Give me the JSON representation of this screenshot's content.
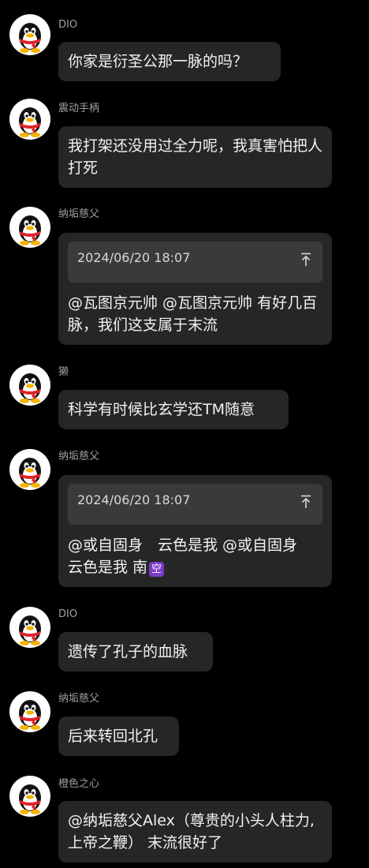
{
  "messages": [
    {
      "sender": "DIO",
      "text": "你家是衍圣公那一脉的吗？"
    },
    {
      "sender": "震动手柄",
      "text": "我打架还没用过全力呢，我真害怕把人打死"
    },
    {
      "sender": "纳垢慈父",
      "quote_time": "2024/06/20 18:07",
      "text": "@瓦图京元帅 @瓦图京元帅 有好几百脉，我们这支属于末流"
    },
    {
      "sender": "獭",
      "text": "科学有时候比玄学还TM随意"
    },
    {
      "sender": "纳垢慈父",
      "quote_time": "2024/06/20 18:07",
      "text": "@或自固身　云色是我 @或自固身　云色是我 南",
      "emoji": "空"
    },
    {
      "sender": "DIO",
      "text": "遗传了孔子的血脉"
    },
    {
      "sender": "纳垢慈父",
      "text": "后来转回北孔"
    },
    {
      "sender": "橙色之心",
      "text": "@纳垢慈父Alex（尊贵的小头人柱力,上帝之鞭） 末流很好了"
    }
  ],
  "colors": {
    "background": "#000000",
    "bubble": "#262626",
    "quote_block": "#3a3a3a",
    "sender_name": "#a0a0a0",
    "message_text": "#f2f2f2"
  },
  "icons": {
    "avatar": "qq-penguin-icon",
    "quote_jump": "scroll-to-quote-arrow-icon"
  }
}
